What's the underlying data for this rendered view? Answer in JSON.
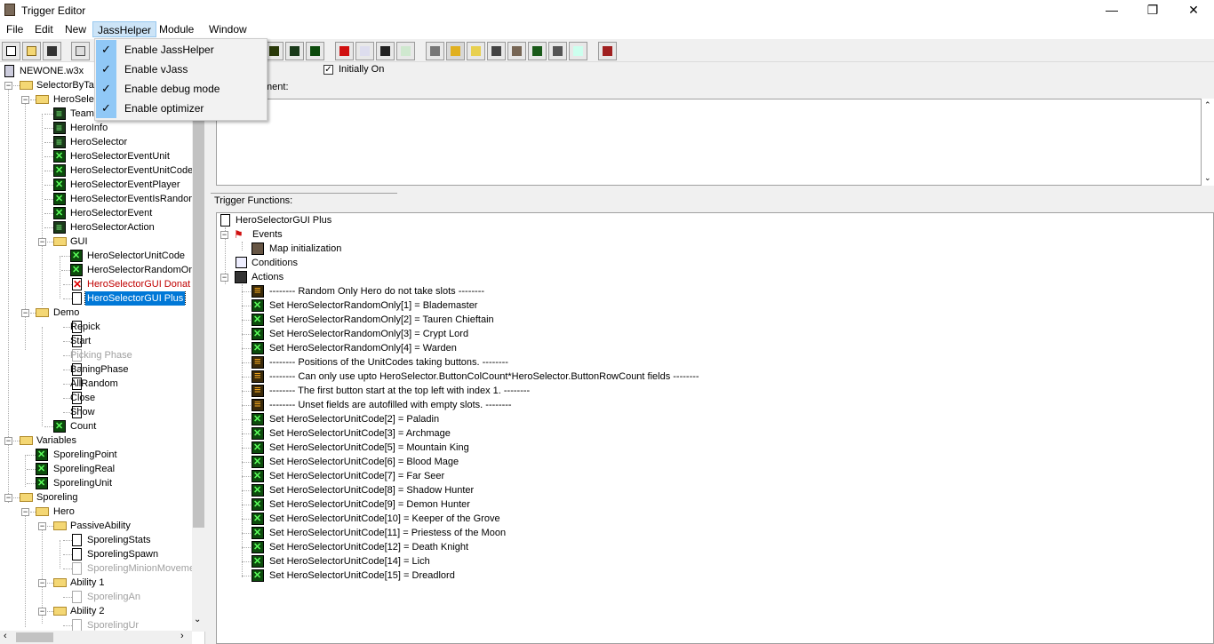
{
  "window": {
    "title": "Trigger Editor",
    "minimize": "—",
    "restore": "❐",
    "close": "✕"
  },
  "menu": [
    "File",
    "Edit",
    "New",
    "JassHelper",
    "Module",
    "Window"
  ],
  "jasshelper_menu": [
    {
      "label": "Enable JassHelper",
      "checked": true
    },
    {
      "label": "Enable vJass",
      "checked": true
    },
    {
      "label": "Enable debug mode",
      "checked": true
    },
    {
      "label": "Enable optimizer",
      "checked": true
    }
  ],
  "tree": {
    "map": "NEWONE.w3x",
    "items": [
      "SelectorByTa",
      "HeroSelec",
      "Team",
      "HeroInfo",
      "HeroSelector",
      "HeroSelectorEventUnit",
      "HeroSelectorEventUnitCode",
      "HeroSelectorEventPlayer",
      "HeroSelectorEventIsRandom",
      "HeroSelectorEvent",
      "HeroSelectorAction",
      "GUI",
      "HeroSelectorUnitCode",
      "HeroSelectorRandomOnl",
      "HeroSelectorGUI Donat",
      "HeroSelectorGUI Plus",
      "Demo",
      "Repick",
      "Start",
      "Picking Phase",
      "BaningPhase",
      "AllRandom",
      "Close",
      "Show",
      "Count",
      "Variables",
      "SporelingPoint",
      "SporelingReal",
      "SporelingUnit",
      "Sporeling",
      "Hero",
      "PassiveAbility",
      "SporelingStats",
      "SporelingSpawn",
      "SporelingMinionMovemer",
      "Ability 1",
      "SporelingAn",
      "Ability 2",
      "SporelingUr"
    ]
  },
  "trigger": {
    "initially_on": "Initially On",
    "comment_label": "ment:",
    "functions_label": "Trigger Functions:",
    "name": "HeroSelectorGUI Plus",
    "events": "Events",
    "event_1": "Map initialization",
    "conditions": "Conditions",
    "actions": "Actions",
    "lines": [
      "-------- Random Only Hero do not take slots --------",
      "Set HeroSelectorRandomOnly[1] = Blademaster",
      "Set HeroSelectorRandomOnly[2] = Tauren Chieftain",
      "Set HeroSelectorRandomOnly[3] = Crypt Lord",
      "Set HeroSelectorRandomOnly[4] = Warden",
      "-------- Positions of the UnitCodes taking buttons. --------",
      "-------- Can only use upto HeroSelector.ButtonColCount*HeroSelector.ButtonRowCount fields --------",
      "-------- The first button start at the top left with index 1. --------",
      "-------- Unset fields are autofilled with empty slots. --------",
      "Set HeroSelectorUnitCode[2] = Paladin",
      "Set HeroSelectorUnitCode[3] = Archmage",
      "Set HeroSelectorUnitCode[5] = Mountain King",
      "Set HeroSelectorUnitCode[6] = Blood Mage",
      "Set HeroSelectorUnitCode[7] = Far Seer",
      "Set HeroSelectorUnitCode[8] = Shadow Hunter",
      "Set HeroSelectorUnitCode[9] = Demon Hunter",
      "Set HeroSelectorUnitCode[10] = Keeper of the Grove",
      "Set HeroSelectorUnitCode[11] = Priestess of the Moon",
      "Set HeroSelectorUnitCode[12] = Death Knight",
      "Set HeroSelectorUnitCode[14] = Lich",
      "Set HeroSelectorUnitCode[15] = Dreadlord"
    ]
  },
  "colors": {
    "selected": "#0078d7",
    "disabled_trigger": "#c00000",
    "menu_highlight": "#cce4f7"
  }
}
